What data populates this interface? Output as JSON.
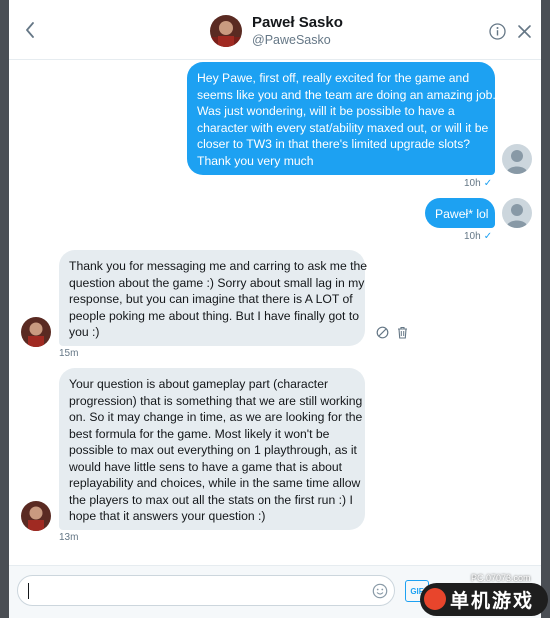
{
  "header": {
    "name": "Paweł Sasko",
    "handle": "@PaweSasko"
  },
  "messages": [
    {
      "from": "me",
      "lines": [
        "Hey Pawe, first off, really excited for the game and",
        "seems like you and the team are doing an amazing job.",
        "Was just wondering, will it be possible to have a",
        "character with every stat/ability maxed out, or will it be",
        "closer to TW3 in that there's limited upgrade slots?",
        "Thank you very much"
      ],
      "time": "10h",
      "status": "✓"
    },
    {
      "from": "me",
      "lines": [
        "Paweł* lol"
      ],
      "time": "10h",
      "status": "✓"
    },
    {
      "from": "them",
      "lines": [
        "Thank you for messaging me and carring to ask me the",
        "question about the game :) Sorry about small lag in my",
        "response, but you can imagine that there is A LOT of",
        "people poking me about thing. But I have finally got to",
        "you :)"
      ],
      "time": "15m"
    },
    {
      "from": "them",
      "lines": [
        "Your question is about gameplay part (character",
        "progression) that is something that we are still working",
        "on. So it may change in time, as we are looking for the",
        "best formula for the game. Most likely it won't be",
        "possible to max out everything on 1 playthrough, as it",
        "would have little sens to have a game that is about",
        "replayability and choices, while in the same time allow",
        "the players to max out all the stats on the first run :) I",
        "hope that it answers your question :)"
      ],
      "time": "13m"
    }
  ],
  "composer": {
    "gif_label": "GIF"
  },
  "watermark": {
    "url": "PC.07073.com",
    "brand": "单机游戏"
  },
  "colors": {
    "accent": "#1da1f2",
    "incoming_bubble": "#e6ecf0",
    "muted_text": "#657786"
  },
  "icons": {
    "back": "chevron-left-icon",
    "info": "info-icon",
    "close": "close-icon",
    "hide": "hide-icon",
    "trash": "trash-icon",
    "emoji": "emoji-icon"
  }
}
